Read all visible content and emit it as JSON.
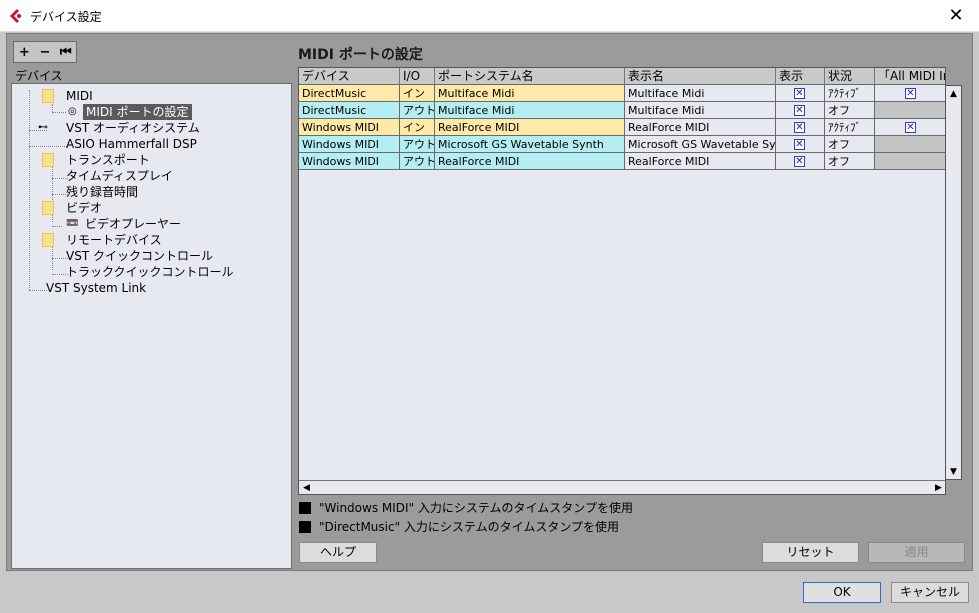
{
  "window": {
    "title": "デバイス設定",
    "close_glyph": "✕"
  },
  "toolbar": {
    "add": "+",
    "remove": "−",
    "reset": "⏮"
  },
  "left_panel": {
    "label": "デバイス"
  },
  "tree": {
    "midi": "MIDI",
    "midi_ports": "MIDI ポートの設定",
    "vst_audio": "VST オーディオシステム",
    "asio": "ASIO Hammerfall DSP",
    "transport": "トランスポート",
    "time_display": "タイムディスプレイ",
    "record_time": "残り録音時間",
    "video": "ビデオ",
    "video_player": "ビデオプレーヤー",
    "remote": "リモートデバイス",
    "vst_quick": "VST クイックコントロール",
    "track_quick": "トラッククイックコントロール",
    "system_link": "VST System Link"
  },
  "panel_title": "MIDI ポートの設定",
  "table": {
    "headers": [
      "デバイス",
      "I/O",
      "ポートシステム名",
      "表示名",
      "表示",
      "状況",
      "「All MIDI In"
    ],
    "rows": [
      {
        "device": "DirectMusic",
        "io": "イン",
        "port": "Multiface Midi",
        "display": "Multiface Midi",
        "status": "ｱｸﾃｨﾌﾞ",
        "kind": "in",
        "show": true,
        "all_in": true
      },
      {
        "device": "DirectMusic",
        "io": "アウト",
        "port": "Multiface Midi",
        "display": "Multiface Midi",
        "status": "オフ",
        "kind": "out",
        "show": true,
        "all_in": null
      },
      {
        "device": "Windows MIDI",
        "io": "イン",
        "port": "RealForce MIDI",
        "display": "RealForce MIDI",
        "status": "ｱｸﾃｨﾌﾞ",
        "kind": "in",
        "show": true,
        "all_in": true
      },
      {
        "device": "Windows MIDI",
        "io": "アウト",
        "port": "Microsoft GS Wavetable Synth",
        "display": "Microsoft GS Wavetable Synt",
        "status": "オフ",
        "kind": "out",
        "show": true,
        "all_in": null
      },
      {
        "device": "Windows MIDI",
        "io": "アウト",
        "port": "RealForce MIDI",
        "display": "RealForce MIDI",
        "status": "オフ",
        "kind": "out",
        "show": true,
        "all_in": null
      }
    ],
    "check_glyph": "✕"
  },
  "options": {
    "windows_midi_timestamp": "\"Windows MIDI\" 入力にシステムのタイムスタンプを使用",
    "directmusic_timestamp": "\"DirectMusic\" 入力にシステムのタイムスタンプを使用"
  },
  "buttons": {
    "help": "ヘルプ",
    "reset": "リセット",
    "apply": "適用",
    "ok": "OK",
    "cancel": "キャンセル"
  }
}
